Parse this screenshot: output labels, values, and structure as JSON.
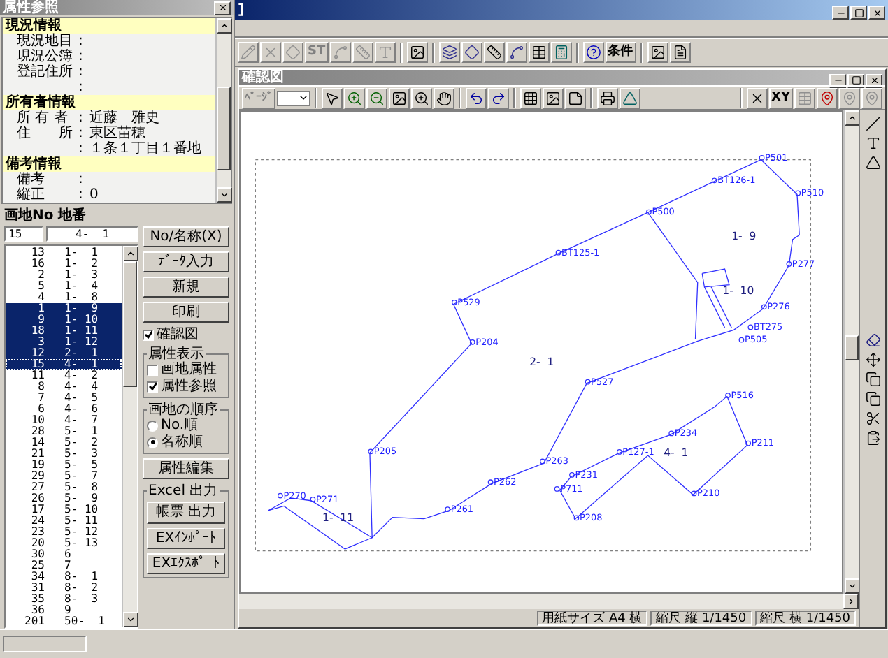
{
  "attr_window": {
    "title": "属性参照",
    "sections": [
      {
        "heading": "現況情報",
        "rows": [
          {
            "label": "現況地目",
            "sep": ":"
          },
          {
            "label": "現況公簿",
            "sep": ":"
          },
          {
            "label": "登記住所",
            "sep": ":"
          },
          {
            "sep": ":"
          }
        ]
      },
      {
        "heading": "所有者情報",
        "rows": [
          {
            "label": "所 有 者",
            "sep": ":",
            "value": "近藤　雅史"
          },
          {
            "label": "住　　所",
            "sep": ":",
            "value": "東区苗穂"
          },
          {
            "sep": ":",
            "value": "１条１丁目１番地"
          }
        ]
      },
      {
        "heading": "備考情報",
        "rows": [
          {
            "label": "備考",
            "sep": ":"
          },
          {
            "label": "縦正",
            "sep": ":",
            "value": "0"
          }
        ]
      }
    ]
  },
  "parcel_panel": {
    "header": "画地No 地番",
    "no_value": "15",
    "chiban_value": "4-  1",
    "rows": [
      {
        "no": "13",
        "chiban": "1-  1",
        "selected": false
      },
      {
        "no": "16",
        "chiban": "1-  2",
        "selected": false
      },
      {
        "no": "2",
        "chiban": "1-  3",
        "selected": false
      },
      {
        "no": "5",
        "chiban": "1-  4",
        "selected": false
      },
      {
        "no": "4",
        "chiban": "1-  8",
        "selected": false
      },
      {
        "no": "1",
        "chiban": "1-  9",
        "selected": true
      },
      {
        "no": "9",
        "chiban": "1- 10",
        "selected": true
      },
      {
        "no": "18",
        "chiban": "1- 11",
        "selected": true
      },
      {
        "no": "3",
        "chiban": "1- 12",
        "selected": true
      },
      {
        "no": "12",
        "chiban": "2-  1",
        "selected": true
      },
      {
        "no": "15",
        "chiban": "4-  1",
        "selected": true,
        "focused": true
      },
      {
        "no": "11",
        "chiban": "4-  2",
        "selected": false
      },
      {
        "no": "8",
        "chiban": "4-  4",
        "selected": false
      },
      {
        "no": "7",
        "chiban": "4-  5",
        "selected": false
      },
      {
        "no": "6",
        "chiban": "4-  6",
        "selected": false
      },
      {
        "no": "10",
        "chiban": "4-  7",
        "selected": false
      },
      {
        "no": "28",
        "chiban": "5-  1",
        "selected": false
      },
      {
        "no": "14",
        "chiban": "5-  2",
        "selected": false
      },
      {
        "no": "21",
        "chiban": "5-  3",
        "selected": false
      },
      {
        "no": "19",
        "chiban": "5-  5",
        "selected": false
      },
      {
        "no": "29",
        "chiban": "5-  7",
        "selected": false
      },
      {
        "no": "27",
        "chiban": "5-  8",
        "selected": false
      },
      {
        "no": "26",
        "chiban": "5-  9",
        "selected": false
      },
      {
        "no": "17",
        "chiban": "5- 10",
        "selected": false
      },
      {
        "no": "24",
        "chiban": "5- 11",
        "selected": false
      },
      {
        "no": "23",
        "chiban": "5- 12",
        "selected": false
      },
      {
        "no": "20",
        "chiban": "5- 13",
        "selected": false
      },
      {
        "no": "30",
        "chiban": "6",
        "selected": false
      },
      {
        "no": "25",
        "chiban": "7",
        "selected": false
      },
      {
        "no": "34",
        "chiban": "8-  1",
        "selected": false
      },
      {
        "no": "31",
        "chiban": "8-  2",
        "selected": false
      },
      {
        "no": "35",
        "chiban": "8-  3",
        "selected": false
      },
      {
        "no": "36",
        "chiban": "9",
        "selected": false
      },
      {
        "no": "201",
        "chiban": "50-  1",
        "selected": false
      }
    ],
    "top_buttons": [
      "No/名称(X)",
      "ﾃﾞｰﾀ入力",
      "新規",
      "印刷"
    ],
    "confirm_map": {
      "label": "確認図",
      "checked": true
    },
    "attr_display": {
      "title": "属性表示",
      "options": [
        {
          "label": "画地属性",
          "checked": false
        },
        {
          "label": "属性参照",
          "checked": true
        }
      ]
    },
    "order": {
      "title": "画地の順序",
      "options": [
        {
          "label": "No.順",
          "selected": false
        },
        {
          "label": "名称順",
          "selected": true
        }
      ]
    },
    "edit_button": "属性編集",
    "excel": {
      "title": "Excel 出力",
      "buttons": [
        "帳票 出力",
        "EXｲﾝﾎﾟｰﾄ",
        "EXｴｸｽﾎﾟｰﾄ"
      ]
    }
  },
  "main_window": {
    "title": "]",
    "toolbar_labels": [
      "ST",
      "条件"
    ]
  },
  "map_window": {
    "title": "確認図",
    "page_label": "ﾍﾟｰｼﾞ",
    "xy_label": "XY",
    "map_labels": [
      {
        "text": "P501",
        "kind": "point"
      },
      {
        "text": "BT126-1",
        "kind": "point"
      },
      {
        "text": "P510",
        "kind": "point"
      },
      {
        "text": "P500",
        "kind": "point"
      },
      {
        "text": "BT125-1",
        "kind": "point"
      },
      {
        "text": "P529",
        "kind": "point"
      },
      {
        "text": "P204",
        "kind": "point"
      },
      {
        "text": "P527",
        "kind": "point"
      },
      {
        "text": "P205",
        "kind": "point"
      },
      {
        "text": "P516",
        "kind": "point"
      },
      {
        "text": "P234",
        "kind": "point"
      },
      {
        "text": "P211",
        "kind": "point"
      },
      {
        "text": "P210",
        "kind": "point"
      },
      {
        "text": "P208",
        "kind": "point"
      },
      {
        "text": "P711",
        "kind": "point"
      },
      {
        "text": "P231",
        "kind": "point"
      },
      {
        "text": "P127-1",
        "kind": "point"
      },
      {
        "text": "P263",
        "kind": "point"
      },
      {
        "text": "P262",
        "kind": "point"
      },
      {
        "text": "P261",
        "kind": "point"
      },
      {
        "text": "P271",
        "kind": "point"
      },
      {
        "text": "P270",
        "kind": "point"
      },
      {
        "text": "BT275",
        "kind": "point"
      },
      {
        "text": "P505",
        "kind": "point"
      },
      {
        "text": "P277",
        "kind": "point"
      },
      {
        "text": "P276",
        "kind": "point"
      },
      {
        "text": "1-  9",
        "kind": "parcel"
      },
      {
        "text": "1-  10",
        "kind": "parcel"
      },
      {
        "text": "2-  1",
        "kind": "parcel"
      },
      {
        "text": "1-  11",
        "kind": "parcel"
      },
      {
        "text": "4-  1",
        "kind": "parcel"
      }
    ],
    "status": [
      "用紙サイズ A4 横",
      "縮尺 縦 1/1450",
      "縮尺 横 1/1450"
    ]
  }
}
